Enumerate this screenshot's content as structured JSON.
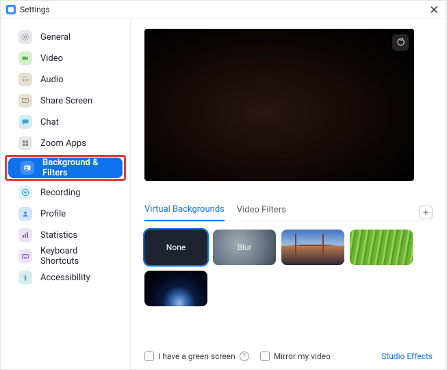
{
  "window": {
    "title": "Settings"
  },
  "sidebar": {
    "items": [
      {
        "label": "General"
      },
      {
        "label": "Video"
      },
      {
        "label": "Audio"
      },
      {
        "label": "Share Screen"
      },
      {
        "label": "Chat"
      },
      {
        "label": "Zoom Apps"
      },
      {
        "label": "Background & Filters"
      },
      {
        "label": "Recording"
      },
      {
        "label": "Profile"
      },
      {
        "label": "Statistics"
      },
      {
        "label": "Keyboard Shortcuts"
      },
      {
        "label": "Accessibility"
      }
    ],
    "active_index": 6
  },
  "tabs": {
    "virtual_bg": "Virtual Backgrounds",
    "video_filters": "Video Filters",
    "active": "virtual_bg"
  },
  "backgrounds": {
    "none_label": "None",
    "blur_label": "Blur",
    "selected": "none"
  },
  "bottom": {
    "green_screen_label": "I have a green screen",
    "mirror_label": "Mirror my video",
    "studio_effects": "Studio Effects"
  },
  "colors": {
    "accent": "#0e72ed",
    "highlight_border": "#e43a3a"
  }
}
